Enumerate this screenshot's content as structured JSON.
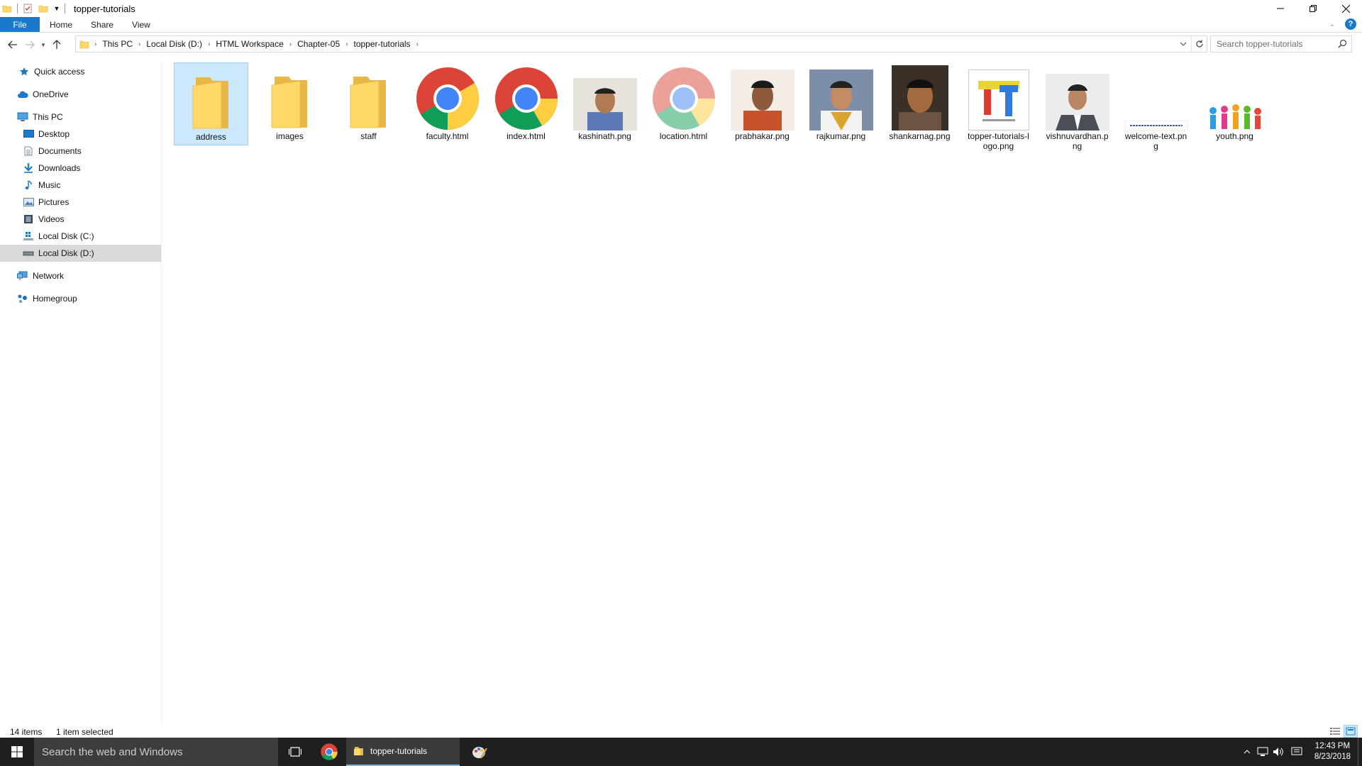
{
  "window": {
    "title": "topper-tutorials"
  },
  "ribbon": {
    "tabs": [
      "File",
      "Home",
      "Share",
      "View"
    ]
  },
  "address": {
    "crumbs": [
      "This PC",
      "Local Disk (D:)",
      "HTML Workspace",
      "Chapter-05",
      "topper-tutorials"
    ]
  },
  "search": {
    "placeholder": "Search topper-tutorials"
  },
  "nav": {
    "quick_access": "Quick access",
    "onedrive": "OneDrive",
    "this_pc": "This PC",
    "desktop": "Desktop",
    "documents": "Documents",
    "downloads": "Downloads",
    "music": "Music",
    "pictures": "Pictures",
    "videos": "Videos",
    "disk_c": "Local Disk (C:)",
    "disk_d": "Local Disk (D:)",
    "network": "Network",
    "homegroup": "Homegroup"
  },
  "files": [
    {
      "name": "address",
      "type": "folder",
      "selected": true
    },
    {
      "name": "images",
      "type": "folder"
    },
    {
      "name": "staff",
      "type": "folder"
    },
    {
      "name": "faculty.html",
      "type": "chrome"
    },
    {
      "name": "index.html",
      "type": "chrome"
    },
    {
      "name": "kashinath.png",
      "type": "photo"
    },
    {
      "name": "location.html",
      "type": "chrome-faded"
    },
    {
      "name": "prabhakar.png",
      "type": "photo"
    },
    {
      "name": "rajkumar.png",
      "type": "photo"
    },
    {
      "name": "shankarnag.png",
      "type": "photo"
    },
    {
      "name": "topper-tutorials-logo.png",
      "type": "logo"
    },
    {
      "name": "vishnuvardhan.png",
      "type": "photo"
    },
    {
      "name": "welcome-text.png",
      "type": "banner"
    },
    {
      "name": "youth.png",
      "type": "youth"
    }
  ],
  "status": {
    "count": "14 items",
    "selection": "1 item selected"
  },
  "taskbar": {
    "search_text": "Search the web and Windows",
    "active_app": "topper-tutorials",
    "time": "12:43 PM",
    "date": "8/23/2018"
  },
  "colors": {
    "accent": "#1979ca",
    "selection": "#cce8ff",
    "folder": "#ffd868",
    "taskbar": "#1f1f1f"
  }
}
